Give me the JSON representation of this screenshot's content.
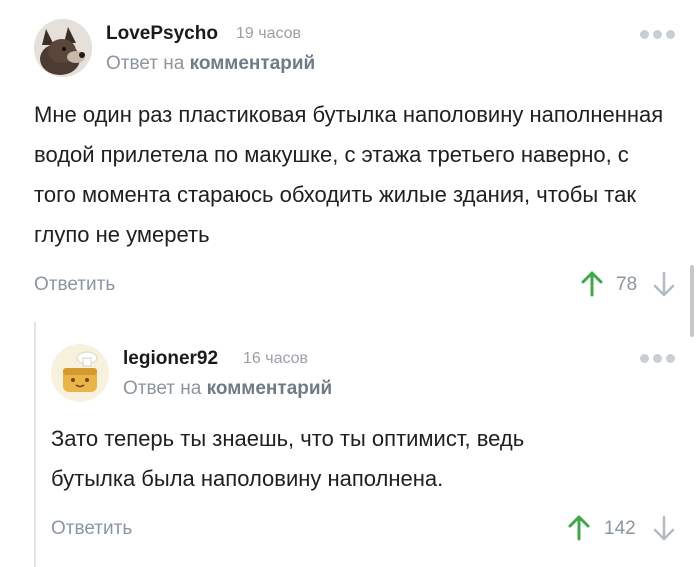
{
  "comments": [
    {
      "author": "LovePsycho",
      "time": "19 часов",
      "reply_prefix": "Ответ на",
      "reply_link": "комментарий",
      "text": "Мне один раз пластиковая бутылка наполовину наполненная водой прилетела по макушке, с этажа третьего наверно, с того момента стараюсь обходить жилые здания, чтобы так глупо не умереть",
      "reply_label": "Ответить",
      "rating": "78",
      "avatar": "dog-avatar"
    },
    {
      "author": "legioner92",
      "time": "16 часов",
      "reply_prefix": "Ответ на",
      "reply_link": "комментарий",
      "text": "Зато теперь ты знаешь, что ты оптимист, ведь бутылка была наполовину наполнена.",
      "reply_label": "Ответить",
      "rating": "142",
      "avatar": "toast-avatar"
    }
  ],
  "colors": {
    "up_arrow": "#3fa64a",
    "down_arrow": "#b3bac1",
    "link": "#6f7c87"
  },
  "icons": [
    "more-dots-icon",
    "arrow-up-icon",
    "arrow-down-icon"
  ]
}
